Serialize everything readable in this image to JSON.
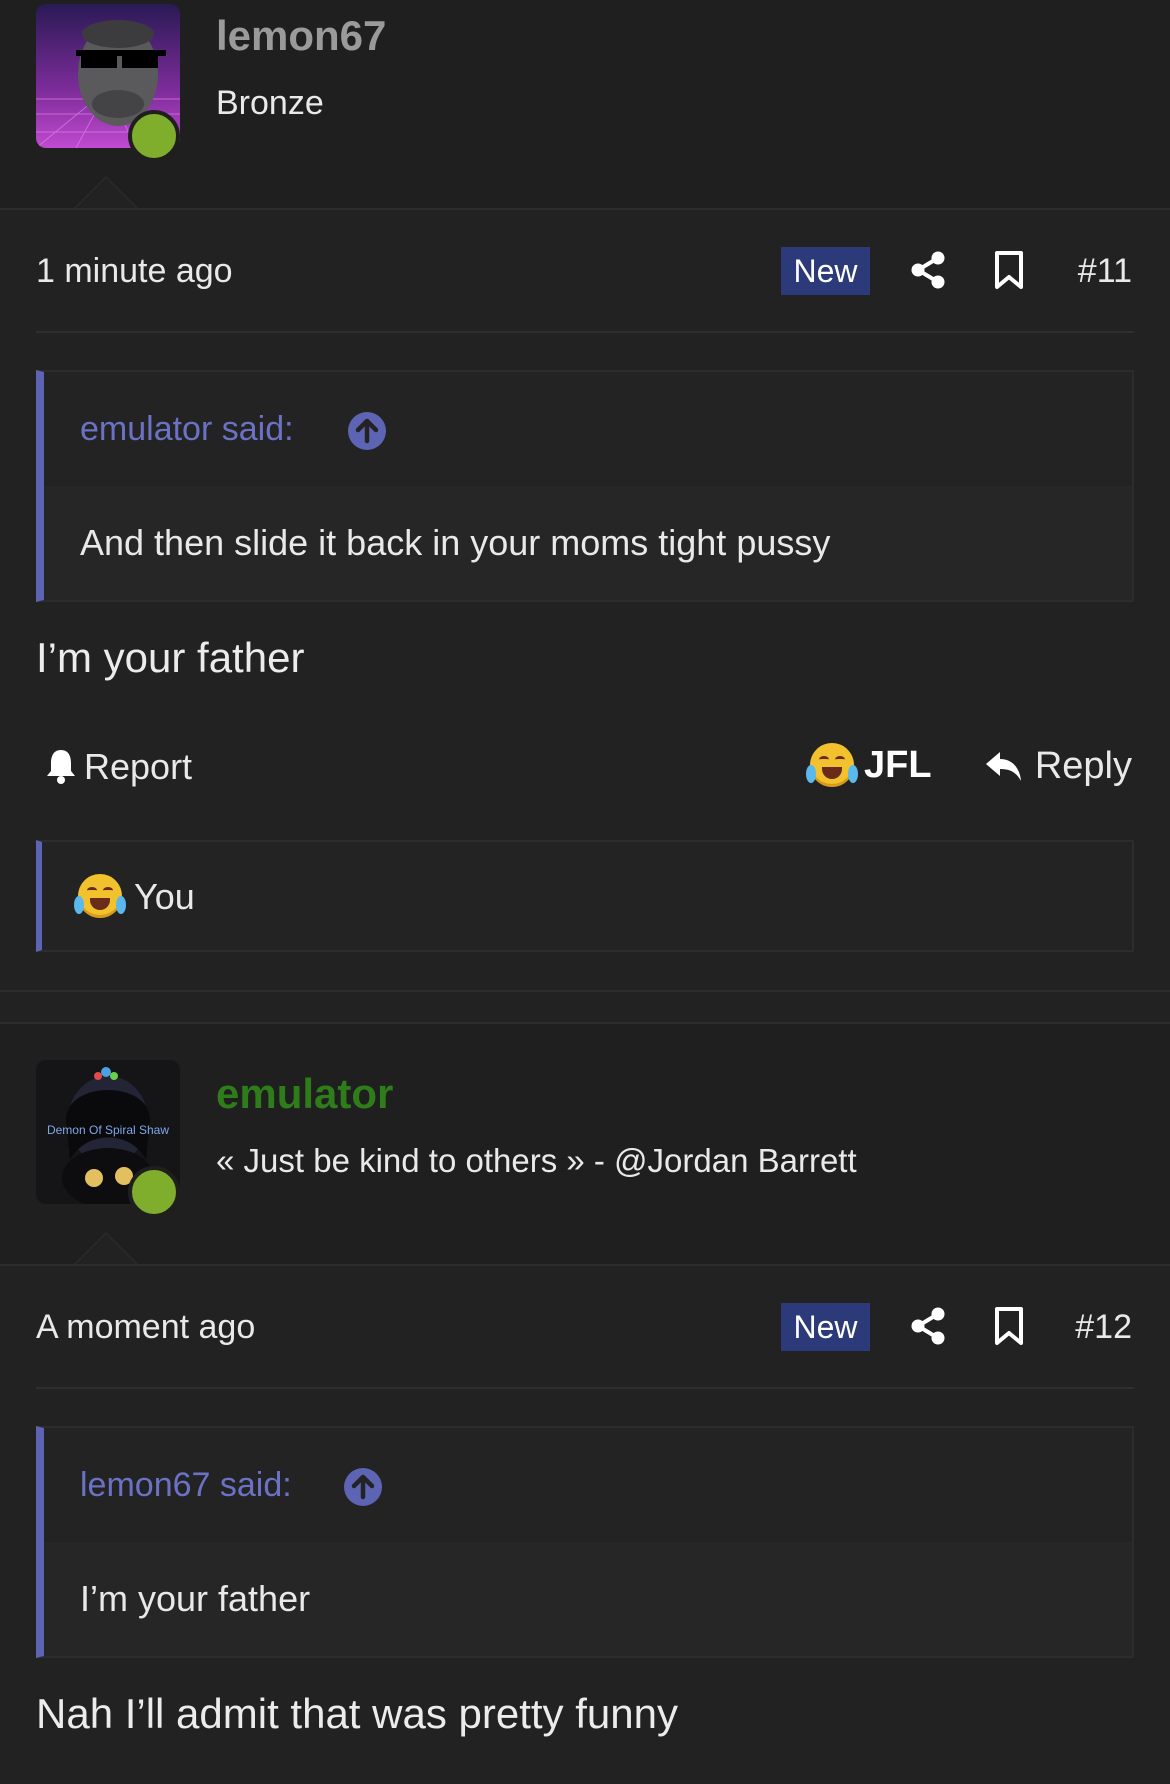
{
  "posts": [
    {
      "username": "lemon67",
      "user_title": "Bronze",
      "timestamp": "1 minute ago",
      "new_badge": "New",
      "post_number": "#11",
      "quote_attribution": "emulator said:",
      "quote_text": "And then slide it back in your moms tight pussy",
      "message": "I’m your father",
      "report_label": "Report",
      "reaction_label": "JFL",
      "reply_label": "Reply",
      "reactions_summary": "You",
      "username_color": "#9a9a9b"
    },
    {
      "username": "emulator",
      "user_title": "« Just be kind to others » - @Jordan Barrett",
      "timestamp": "A moment ago",
      "new_badge": "New",
      "post_number": "#12",
      "quote_attribution": "lemon67 said:",
      "quote_text": "I’m your father",
      "message": "Nah I’ll admit that was pretty funny",
      "username_color": "#2e7d1a",
      "avatar_text": "Demon Of Spiral Shaw"
    }
  ],
  "colors": {
    "background": "#222223",
    "accent": "#5d64b3",
    "online": "#7fae2c",
    "badge": "#2d3a7a"
  },
  "icons": [
    "share-icon",
    "bookmark-icon",
    "bell-icon",
    "reply-icon",
    "arrow-up-circle-icon",
    "joy-emoji-icon"
  ]
}
